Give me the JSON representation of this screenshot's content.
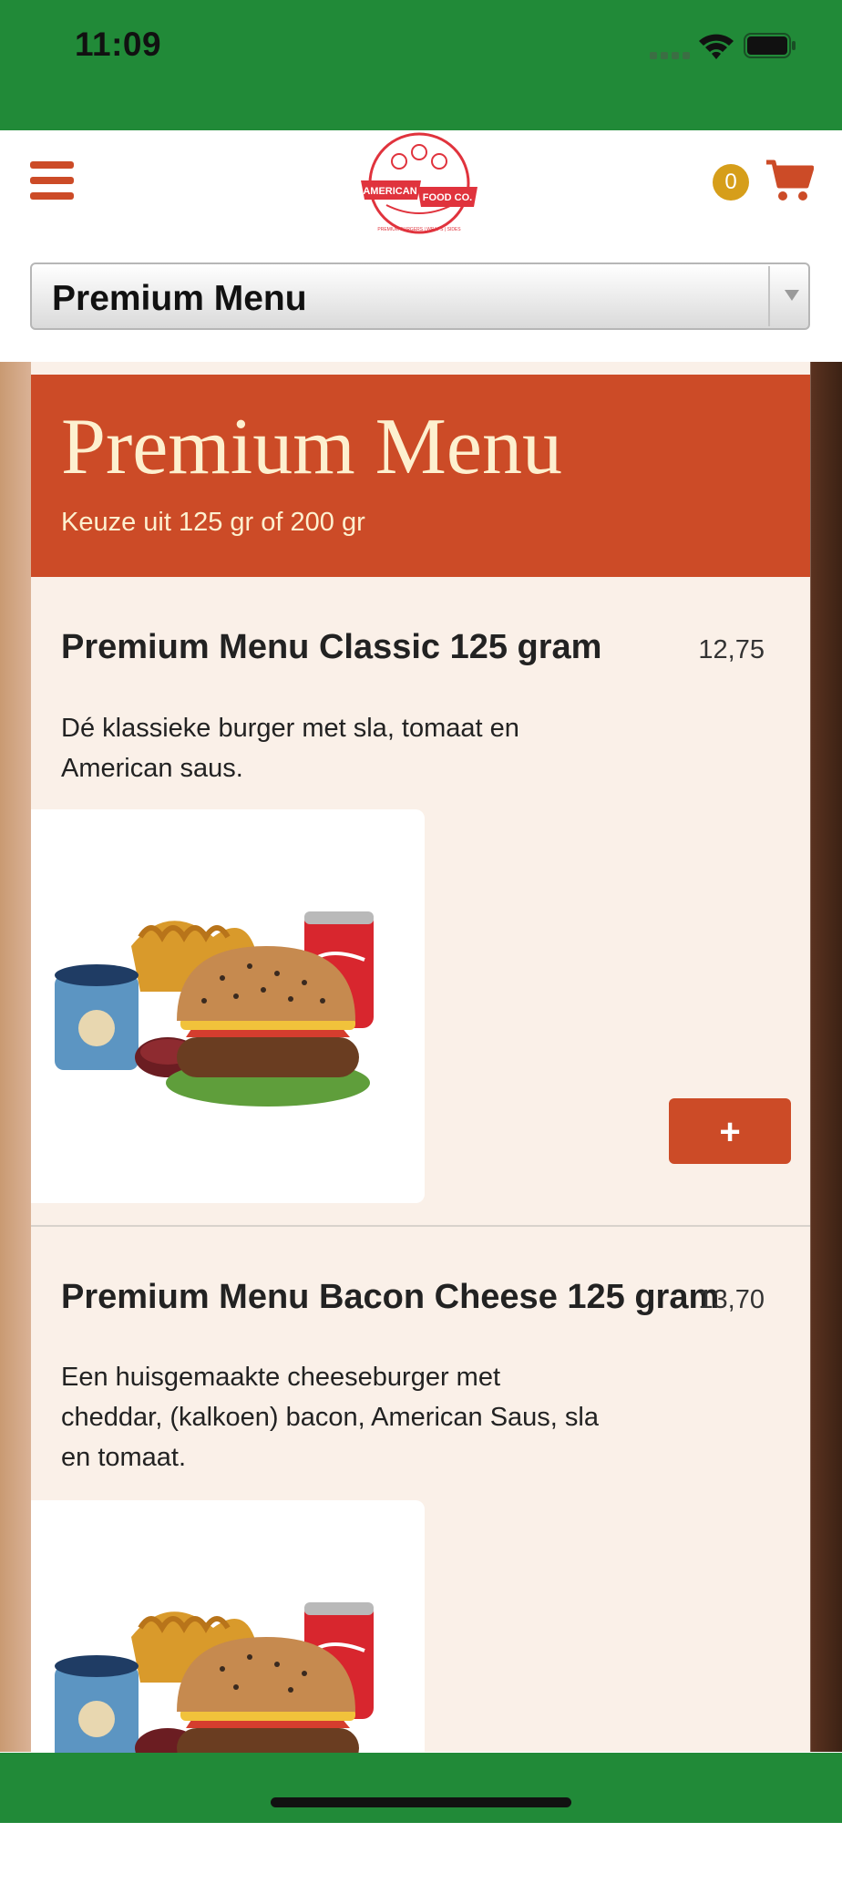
{
  "status_bar": {
    "time": "11:09",
    "icons": [
      "cellular-signal-icon",
      "wifi-icon",
      "battery-icon"
    ],
    "background": "#218a38"
  },
  "header": {
    "menu_icon": "hamburger-menu-icon",
    "logo": {
      "name": "American Food Co.",
      "line1": "AMERICAN",
      "line2": "FOOD CO.",
      "tagline": "PREMIUM BURGERS | WRAPS | SIDES"
    },
    "cart": {
      "count": "0",
      "icon": "shopping-cart-icon"
    }
  },
  "category_select": {
    "selected": "Premium Menu",
    "icon": "dropdown-arrow-icon"
  },
  "category": {
    "title": "Premium Menu",
    "subtitle": "Keuze uit 125 gr of 200 gr"
  },
  "products": [
    {
      "name": "Premium Menu Classic 125 gram",
      "price": "12,75",
      "description": "Dé klassieke burger met sla, tomaat en American saus.",
      "add_label": "+",
      "image": "burger-menu-photo"
    },
    {
      "name": "Premium Menu Bacon Cheese 125 gram",
      "price": "13,70",
      "description": "Een huisgemaakte cheeseburger met cheddar, (kalkoen) bacon, American Saus, sla en tomaat.",
      "image": "burger-menu-photo"
    }
  ],
  "colors": {
    "status_green": "#218a38",
    "brand_orange": "#cc4b27",
    "banner_text": "#fdf0cf",
    "card_background": "#faf0e8",
    "cart_badge": "#d69e1a"
  }
}
